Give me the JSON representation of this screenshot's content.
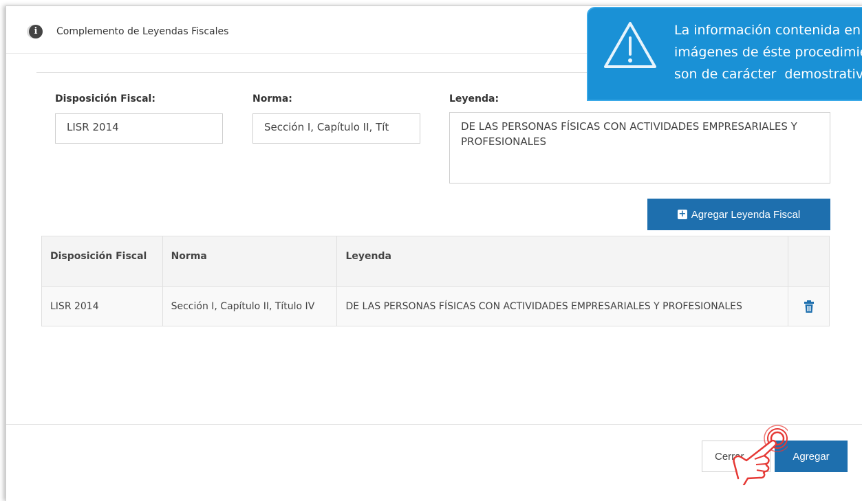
{
  "modal": {
    "title": "Complemento de Leyendas Fiscales"
  },
  "form": {
    "disposicion_label": "Disposición Fiscal:",
    "disposicion_value": "LISR 2014",
    "norma_label": "Norma:",
    "norma_value": "Sección I, Capítulo II, Tít",
    "leyenda_label": "Leyenda:",
    "leyenda_value": "DE LAS PERSONAS FÍSICAS CON ACTIVIDADES EMPRESARIALES Y PROFESIONALES",
    "add_button": "Agregar Leyenda Fiscal"
  },
  "table": {
    "headers": [
      "Disposición Fiscal",
      "Norma",
      "Leyenda",
      ""
    ],
    "rows": [
      {
        "disposicion": "LISR 2014",
        "norma": "Sección I, Capítulo II, Título IV",
        "leyenda": "DE LAS PERSONAS FÍSICAS CON ACTIVIDADES EMPRESARIALES Y PROFESIONALES",
        "action_icon": "trash-icon"
      }
    ]
  },
  "footer": {
    "cerrar_label": "Cerrar",
    "agregar_label": "Agregar"
  },
  "tooltip": {
    "text": "La información contenida en las\nimágenes de éste procedimiento\nson de carácter  demostrativo",
    "icon": "warning-icon"
  },
  "colors": {
    "primary": "#1e6fae",
    "tooltip": "#1a91d6"
  }
}
